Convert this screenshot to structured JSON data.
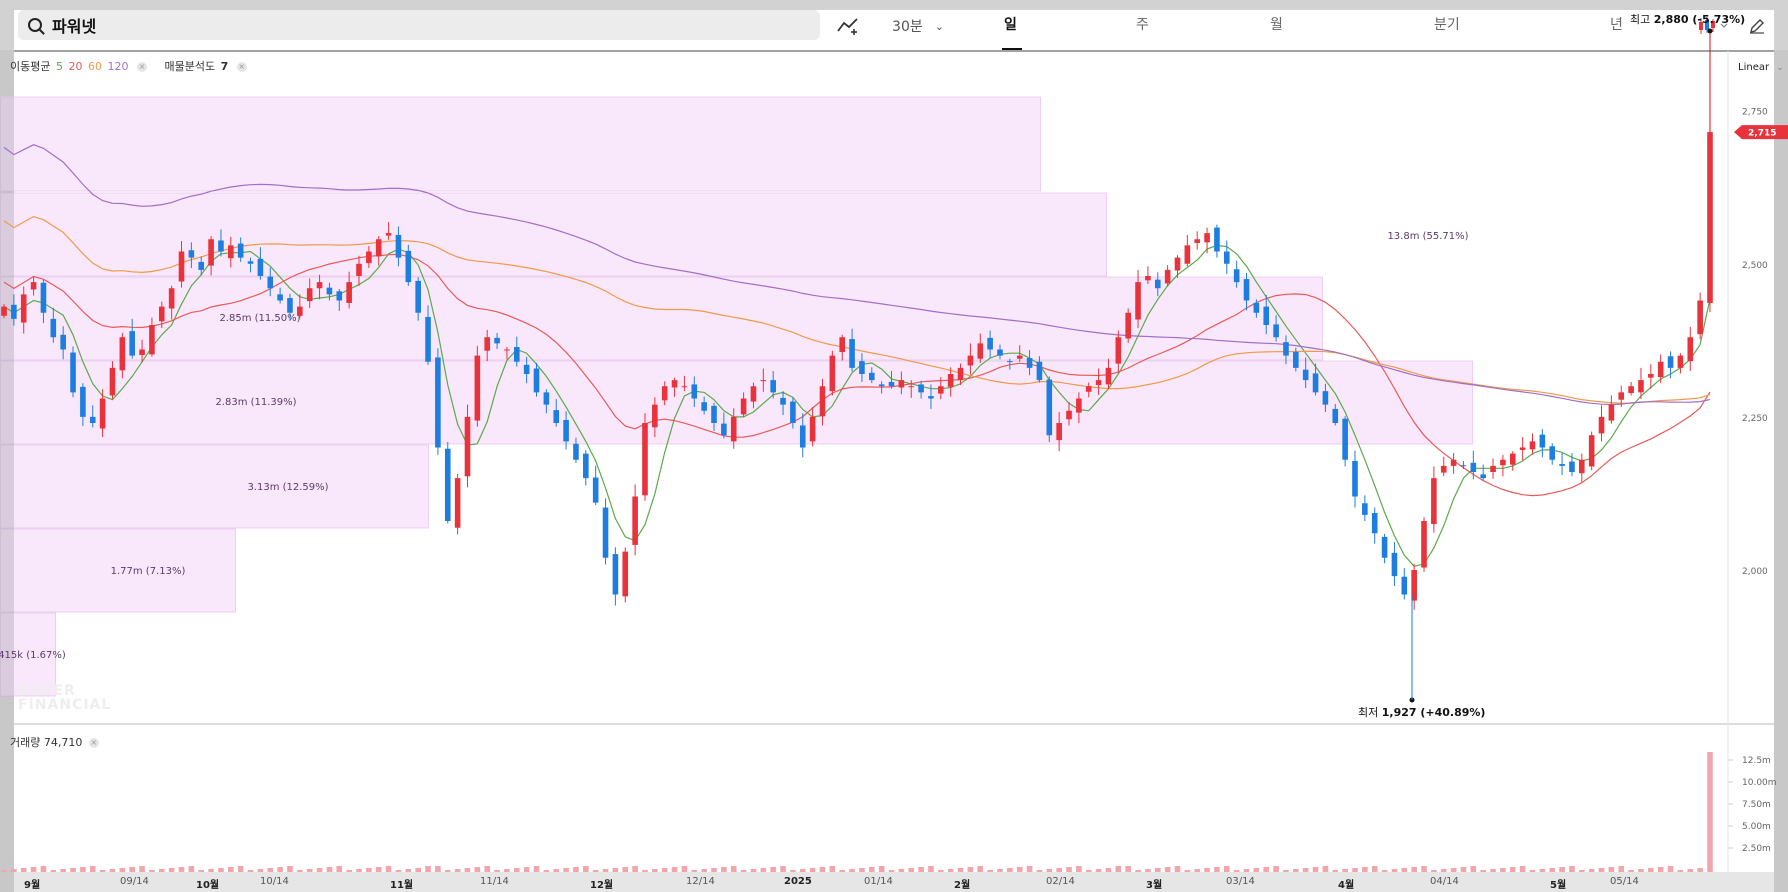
{
  "search": {
    "value": "파워넷"
  },
  "toolbar": {
    "interval": "30분",
    "interval_caret": "⌄"
  },
  "tabs": [
    {
      "label": "일",
      "active": true
    },
    {
      "label": "주",
      "active": false
    },
    {
      "label": "월",
      "active": false
    },
    {
      "label": "분기",
      "active": false
    },
    {
      "label": "년",
      "active": false
    }
  ],
  "legend": {
    "ma_label": "이동평균",
    "ma_periods": [
      "5",
      "20",
      "60",
      "120"
    ],
    "ma_colors": [
      "#5aaa4a",
      "#e85a5a",
      "#f09a4a",
      "#a070c8"
    ],
    "vp_label": "매물분석도",
    "vp_value": "7",
    "close": "×"
  },
  "scale_mode": "Linear",
  "price_axis": {
    "ticks": [
      "2,750",
      "2,500",
      "2,250",
      "2,000"
    ],
    "current": "2,715"
  },
  "volume_axis": {
    "ticks": [
      "12.5m",
      "10.00m",
      "7.50m",
      "5.00m",
      "2.50m"
    ]
  },
  "annotations": {
    "high_label": "최고",
    "high_value": "2,880",
    "high_change": "(-5.73%)",
    "low_label": "최저",
    "low_value": "1,927",
    "low_change": "(+40.89%)"
  },
  "volume_profile": [
    {
      "label": "13.8m (55.71%)"
    },
    {
      "label": "2.85m (11.50%)"
    },
    {
      "label": "2.83m (11.39%)"
    },
    {
      "label": "3.13m (12.59%)"
    },
    {
      "label": "1.77m (7.13%)"
    },
    {
      "label": "415k (1.67%)"
    }
  ],
  "volume": {
    "label": "거래량",
    "value": "74,710"
  },
  "watermark": [
    "NAVER",
    "FINANCIAL"
  ],
  "x_labels": [
    {
      "text": "9월",
      "strong": true
    },
    {
      "text": "09/14",
      "strong": false
    },
    {
      "text": "10월",
      "strong": true
    },
    {
      "text": "10/14",
      "strong": false
    },
    {
      "text": "11월",
      "strong": true
    },
    {
      "text": "11/14",
      "strong": false
    },
    {
      "text": "12월",
      "strong": true
    },
    {
      "text": "12/14",
      "strong": false
    },
    {
      "text": "2025",
      "strong": true
    },
    {
      "text": "01/14",
      "strong": false
    },
    {
      "text": "2월",
      "strong": true
    },
    {
      "text": "02/14",
      "strong": false
    },
    {
      "text": "3월",
      "strong": true
    },
    {
      "text": "03/14",
      "strong": false
    },
    {
      "text": "4월",
      "strong": true
    },
    {
      "text": "04/14",
      "strong": false
    },
    {
      "text": "5월",
      "strong": true
    },
    {
      "text": "05/14",
      "strong": false
    }
  ],
  "chart_data": {
    "type": "candlestick",
    "up_color": "#e8323c",
    "down_color": "#1e7ee0",
    "price_range": [
      1900,
      2930
    ],
    "high": 2880,
    "low": 1927,
    "current": 2715,
    "moving_averages": [
      {
        "name": "5",
        "color": "#5aaa4a"
      },
      {
        "name": "20",
        "color": "#e85a5a"
      },
      {
        "name": "60",
        "color": "#f09a4a"
      },
      {
        "name": "120",
        "color": "#a070c8"
      }
    ]
  }
}
